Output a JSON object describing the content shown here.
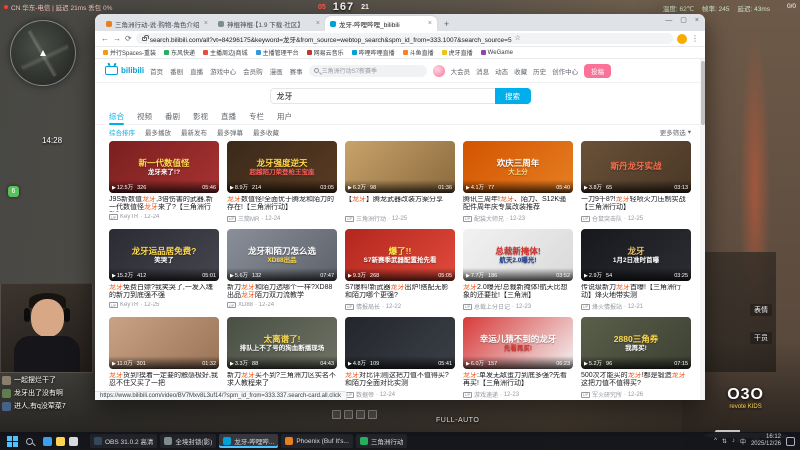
{
  "icons": {
    "back": "←",
    "forward": "→",
    "reload": "⟳",
    "star": "☆",
    "menu": "⋮",
    "minimize": "—",
    "maximize": "▢",
    "close": "×",
    "new_tab": "+",
    "play": "▶",
    "up": "UP",
    "caret_down": "▾",
    "tray_caret": "^",
    "tray_net": "⇅",
    "tray_vol": "♪"
  },
  "game": {
    "top_status_left": "CN 华东-电信 | 延迟 21ms 丢包 0%",
    "hud_center": {
      "left": "05",
      "score": "167",
      "right": "21"
    },
    "hud_right": {
      "temp": "温度: 62℃",
      "fps": "帧率: 245",
      "ping": "延迟: 43ms"
    },
    "kd": "0/0",
    "minimap_time": "14:28",
    "squad_marker": "6",
    "side_labels": [
      "表情",
      "干员"
    ],
    "fire_mode": "FULL-AUTO",
    "watermark_main": "O3O",
    "watermark_sub": "revote KIDS",
    "chat": [
      {
        "color": "#8a7f6a",
        "text": "一起摆烂干了"
      },
      {
        "color": "#5f7d4f",
        "text": "龙牙出了没有啊"
      },
      {
        "color": "#46628a",
        "text": "进人,有q没荤菜7"
      }
    ]
  },
  "browser": {
    "tabs": [
      {
        "label": "三角洲行动-说·购物-角色介绍",
        "color": "#e67e22"
      },
      {
        "label": "神棍神棍·【1.9 下载·社区】",
        "color": "#7f8c8d"
      },
      {
        "label": "龙牙-哔哩哔哩_bilibili",
        "color": "#00a1d6",
        "active": true
      }
    ],
    "url": "search.bilibili.com/all?vt=84296175&keyword=龙牙&from_source=webtop_search&spm_id_from=333.1007&search_source=5",
    "bookmarks": [
      {
        "label": "并行Spaces-重装",
        "color": "#f39c12"
      },
      {
        "label": "东风快递",
        "color": "#27ae60"
      },
      {
        "label": "主播周边|商城",
        "color": "#e74c3c"
      },
      {
        "label": "主播管理平台",
        "color": "#3498db"
      },
      {
        "label": "网易云音乐",
        "color": "#c0392b"
      },
      {
        "label": "哔哩哔哩直播",
        "color": "#00a1d6"
      },
      {
        "label": "斗鱼直播",
        "color": "#ff7f27"
      },
      {
        "label": "虎牙直播",
        "color": "#f1c40f"
      },
      {
        "label": "WeGame",
        "color": "#8e44ad"
      }
    ],
    "status_link": "https://www.bilibili.com/video/BV7Mxv8L3uf14/?spm_id_from=333.337.search-card.all.click"
  },
  "bili": {
    "logo": "bilibili",
    "nav": [
      "首页",
      "番剧",
      "直播",
      "游戏中心",
      "会员购",
      "漫画",
      "赛事"
    ],
    "header_search_placeholder": "三角洲行动S7新赛季",
    "header_actions": [
      "大会员",
      "消息",
      "动态",
      "收藏",
      "历史",
      "创作中心"
    ],
    "upload_btn": "投稿",
    "search_keyword": "龙牙",
    "search_btn": "搜索",
    "result_tabs": [
      {
        "label": "综合",
        "active": true
      },
      {
        "label": "视频"
      },
      {
        "label": "番剧"
      },
      {
        "label": "影视"
      },
      {
        "label": "直播"
      },
      {
        "label": "专栏"
      },
      {
        "label": "用户"
      }
    ],
    "sort_options": [
      {
        "label": "综合排序",
        "active": true
      },
      {
        "label": "最多播放"
      },
      {
        "label": "最新发布"
      },
      {
        "label": "最多弹幕"
      },
      {
        "label": "最多收藏"
      }
    ],
    "filter_more": "更多筛选"
  },
  "videos": [
    {
      "bg": "linear-gradient(135deg,#7a1f1f,#a83232)",
      "tt1": "新一代数值怪",
      "tc1": "#ffd94d",
      "tt2": "龙牙来了!?",
      "tc2": "#ffffff",
      "dur": "05:46",
      "views": "12.5万",
      "dm": "326",
      "title": "J9S新数值龙牙,3倍伤害的武器,新一代数值怪龙牙来了?【三角洲行动】",
      "up": "KeyTR",
      "date": "12-24"
    },
    {
      "bg": "linear-gradient(135deg,#3a2a1a,#5a3a22)",
      "tt1": "龙牙强度逆天",
      "tc1": "#ffd94d",
      "tt2": "超越陌刀荣登枪王宝座",
      "tc2": "#ff5c5c",
      "dur": "03:05",
      "views": "8.9万",
      "dm": "214",
      "title": "龙牙数值怪!全面优于腾龙和陌刀的存在!【三角洲行动】",
      "up": "三筒MR",
      "date": "12-24"
    },
    {
      "bg": "linear-gradient(135deg,#c9a36a,#8a6a3e)",
      "dur": "01:36",
      "views": "6.2万",
      "dm": "98",
      "title": "【龙牙】腾龙武器改装方案分享",
      "up": "三角洲行动",
      "date": "12-25"
    },
    {
      "bg": "linear-gradient(135deg,#d35400,#e67e22)",
      "tt1": "欢庆三周年",
      "tc1": "#ffffff",
      "tt2": "大上分",
      "tc2": "#ffe08a",
      "dur": "05:40",
      "views": "4.1万",
      "dm": "77",
      "title": "腾讯三周年!龙牙、陌刀、S12K骚配件周年庆专属改装推荐",
      "up": "配装大师兄",
      "date": "12-23"
    },
    {
      "bg": "linear-gradient(135deg,#6a5138,#4a3726)",
      "tt1": "斯丹龙牙实战",
      "tc1": "#ff6b4a",
      "dur": "03:13",
      "views": "3.8万",
      "dm": "65",
      "title": "一刀9千8?!龙牙轻喷火力压制实战【三角洲行动】",
      "up": "仓鼠突击队",
      "date": "12-25"
    },
    {
      "bg": "linear-gradient(135deg,#2b2b33,#45454f)",
      "tt1": "龙牙运品居免费?",
      "tc1": "#ffd94d",
      "tt2": "笑哭了",
      "tc2": "#ffffff",
      "dur": "05:01",
      "views": "15.2万",
      "dm": "412",
      "title": "龙牙免费白嫖?我笑哭了,一发入魂的新刀到底强不强",
      "up": "KeyTR",
      "date": "12-25"
    },
    {
      "bg": "linear-gradient(135deg,#8a8f99,#5d626b)",
      "tt1": "龙牙和陌刀怎么选",
      "tc1": "#ffffff",
      "tt2": "XD88出品",
      "tc2": "#ffd94d",
      "dur": "07:47",
      "views": "5.6万",
      "dm": "132",
      "title": "新刀龙牙和陌刀选哪个一样?XD88出品龙牙陌刀双刀流教学",
      "up": "XD88",
      "date": "12-24"
    },
    {
      "bg": "linear-gradient(135deg,#b3261e,#e04a3a)",
      "tt1": "爆了!!",
      "tc1": "#ffe94d",
      "tt2": "S7新赛季武器配置抢先看",
      "tc2": "#ffffff",
      "dur": "05:05",
      "views": "9.3万",
      "dm": "268",
      "title": "S7爆料!新武器龙牙出炉!搭配无影和陌刀哪个更强?",
      "up": "情报局长",
      "date": "12-22"
    },
    {
      "bg": "linear-gradient(135deg,#f2f2f2,#d9d9d9)",
      "tt1": "总裁新掩体!",
      "tc1": "#d2302a",
      "tt2": "航天2.0曝光!",
      "tc2": "#1f3f8f",
      "dur": "03:52",
      "views": "7.7万",
      "dm": "186",
      "title": "龙牙2.0曝光!总裁新掩体!航天比想象的还要扯!【三角洲】",
      "up": "总裁上分日记",
      "date": "12-23"
    },
    {
      "bg": "linear-gradient(135deg,#17181c,#2c2d33)",
      "tt1": "龙牙",
      "tc1": "#e8c372",
      "tt2": "1月2日准时首曝",
      "tc2": "#ffffff",
      "dur": "03:25",
      "views": "2.9万",
      "dm": "54",
      "title": "传说级新刀龙牙首曝!【三角洲行动】烽火地带实测",
      "up": "烽火情报站",
      "date": "12-21"
    },
    {
      "bg": "linear-gradient(135deg,#caa285,#9a7458)",
      "dur": "01:32",
      "views": "11.0万",
      "dm": "301",
      "title": "龙牙货到!摸着一定要的触感极好,我忍不住又买了一把",
      "up": "开箱老哥",
      "date": "12-26"
    },
    {
      "bg": "linear-gradient(135deg,#4a4f45,#6d7263)",
      "tt1": "太离谱了!",
      "tc1": "#ffd94d",
      "tt2": "排队上不了号的狗血断播现场",
      "tc2": "#ffffff",
      "dur": "04:43",
      "views": "3.3万",
      "dm": "88",
      "title": "新刀龙牙买不到?三角洲刀区实名不求人教程来了",
      "up": "攻略酱",
      "date": "12-25"
    },
    {
      "bg": "linear-gradient(135deg,#23262b,#3a3f47)",
      "dur": "05:41",
      "views": "4.8万",
      "dm": "109",
      "title": "龙牙对比评测|这把刀值不值得买?和陌刀全面对比实测",
      "up": "数据帝",
      "date": "12-24"
    },
    {
      "bg": "linear-gradient(135deg,#d93a3a,#f2f2f2)",
      "tt1": "幸运儿猜不到的龙牙",
      "tc1": "#ffffff",
      "tt2": "先看再买!",
      "tc2": "#d2302a",
      "dur": "06:23",
      "views": "6.0万",
      "dm": "157",
      "title": "龙牙:单发无敌蛋刀到底多强?先看再买!【三角洲行动】",
      "up": "游戏速递",
      "date": "12-23"
    },
    {
      "bg": "linear-gradient(135deg,#5a5f4a,#3d4134)",
      "tt1": "2880三角券",
      "tc1": "#ffd94d",
      "tt2": "我再买!",
      "tc2": "#ffffff",
      "dur": "07:15",
      "views": "5.2万",
      "dm": "96",
      "title": "500次才能买的龙牙!都是锻造龙牙这把刀值不值得买?",
      "up": "军火研究所",
      "date": "12-26"
    }
  ],
  "taskbar": {
    "pinned": [
      {
        "color": "#3aa0f0"
      },
      {
        "color": "#ffd34d"
      },
      {
        "color": "#d6d9de"
      }
    ],
    "apps": [
      {
        "label": "OBS 31.0.2 高清",
        "color": "#34495e"
      },
      {
        "label": "全境封锁(影)",
        "color": "#7f8c8d"
      },
      {
        "label": "龙牙-哔哩哔...",
        "color": "#00a1d6",
        "active": true
      },
      {
        "label": "Phoenix (Buf It's...",
        "color": "#e67e22"
      },
      {
        "label": "三角洲行动",
        "color": "#27ae60"
      }
    ],
    "ime": "中",
    "time": "16:12",
    "date": "2025/12/26"
  }
}
